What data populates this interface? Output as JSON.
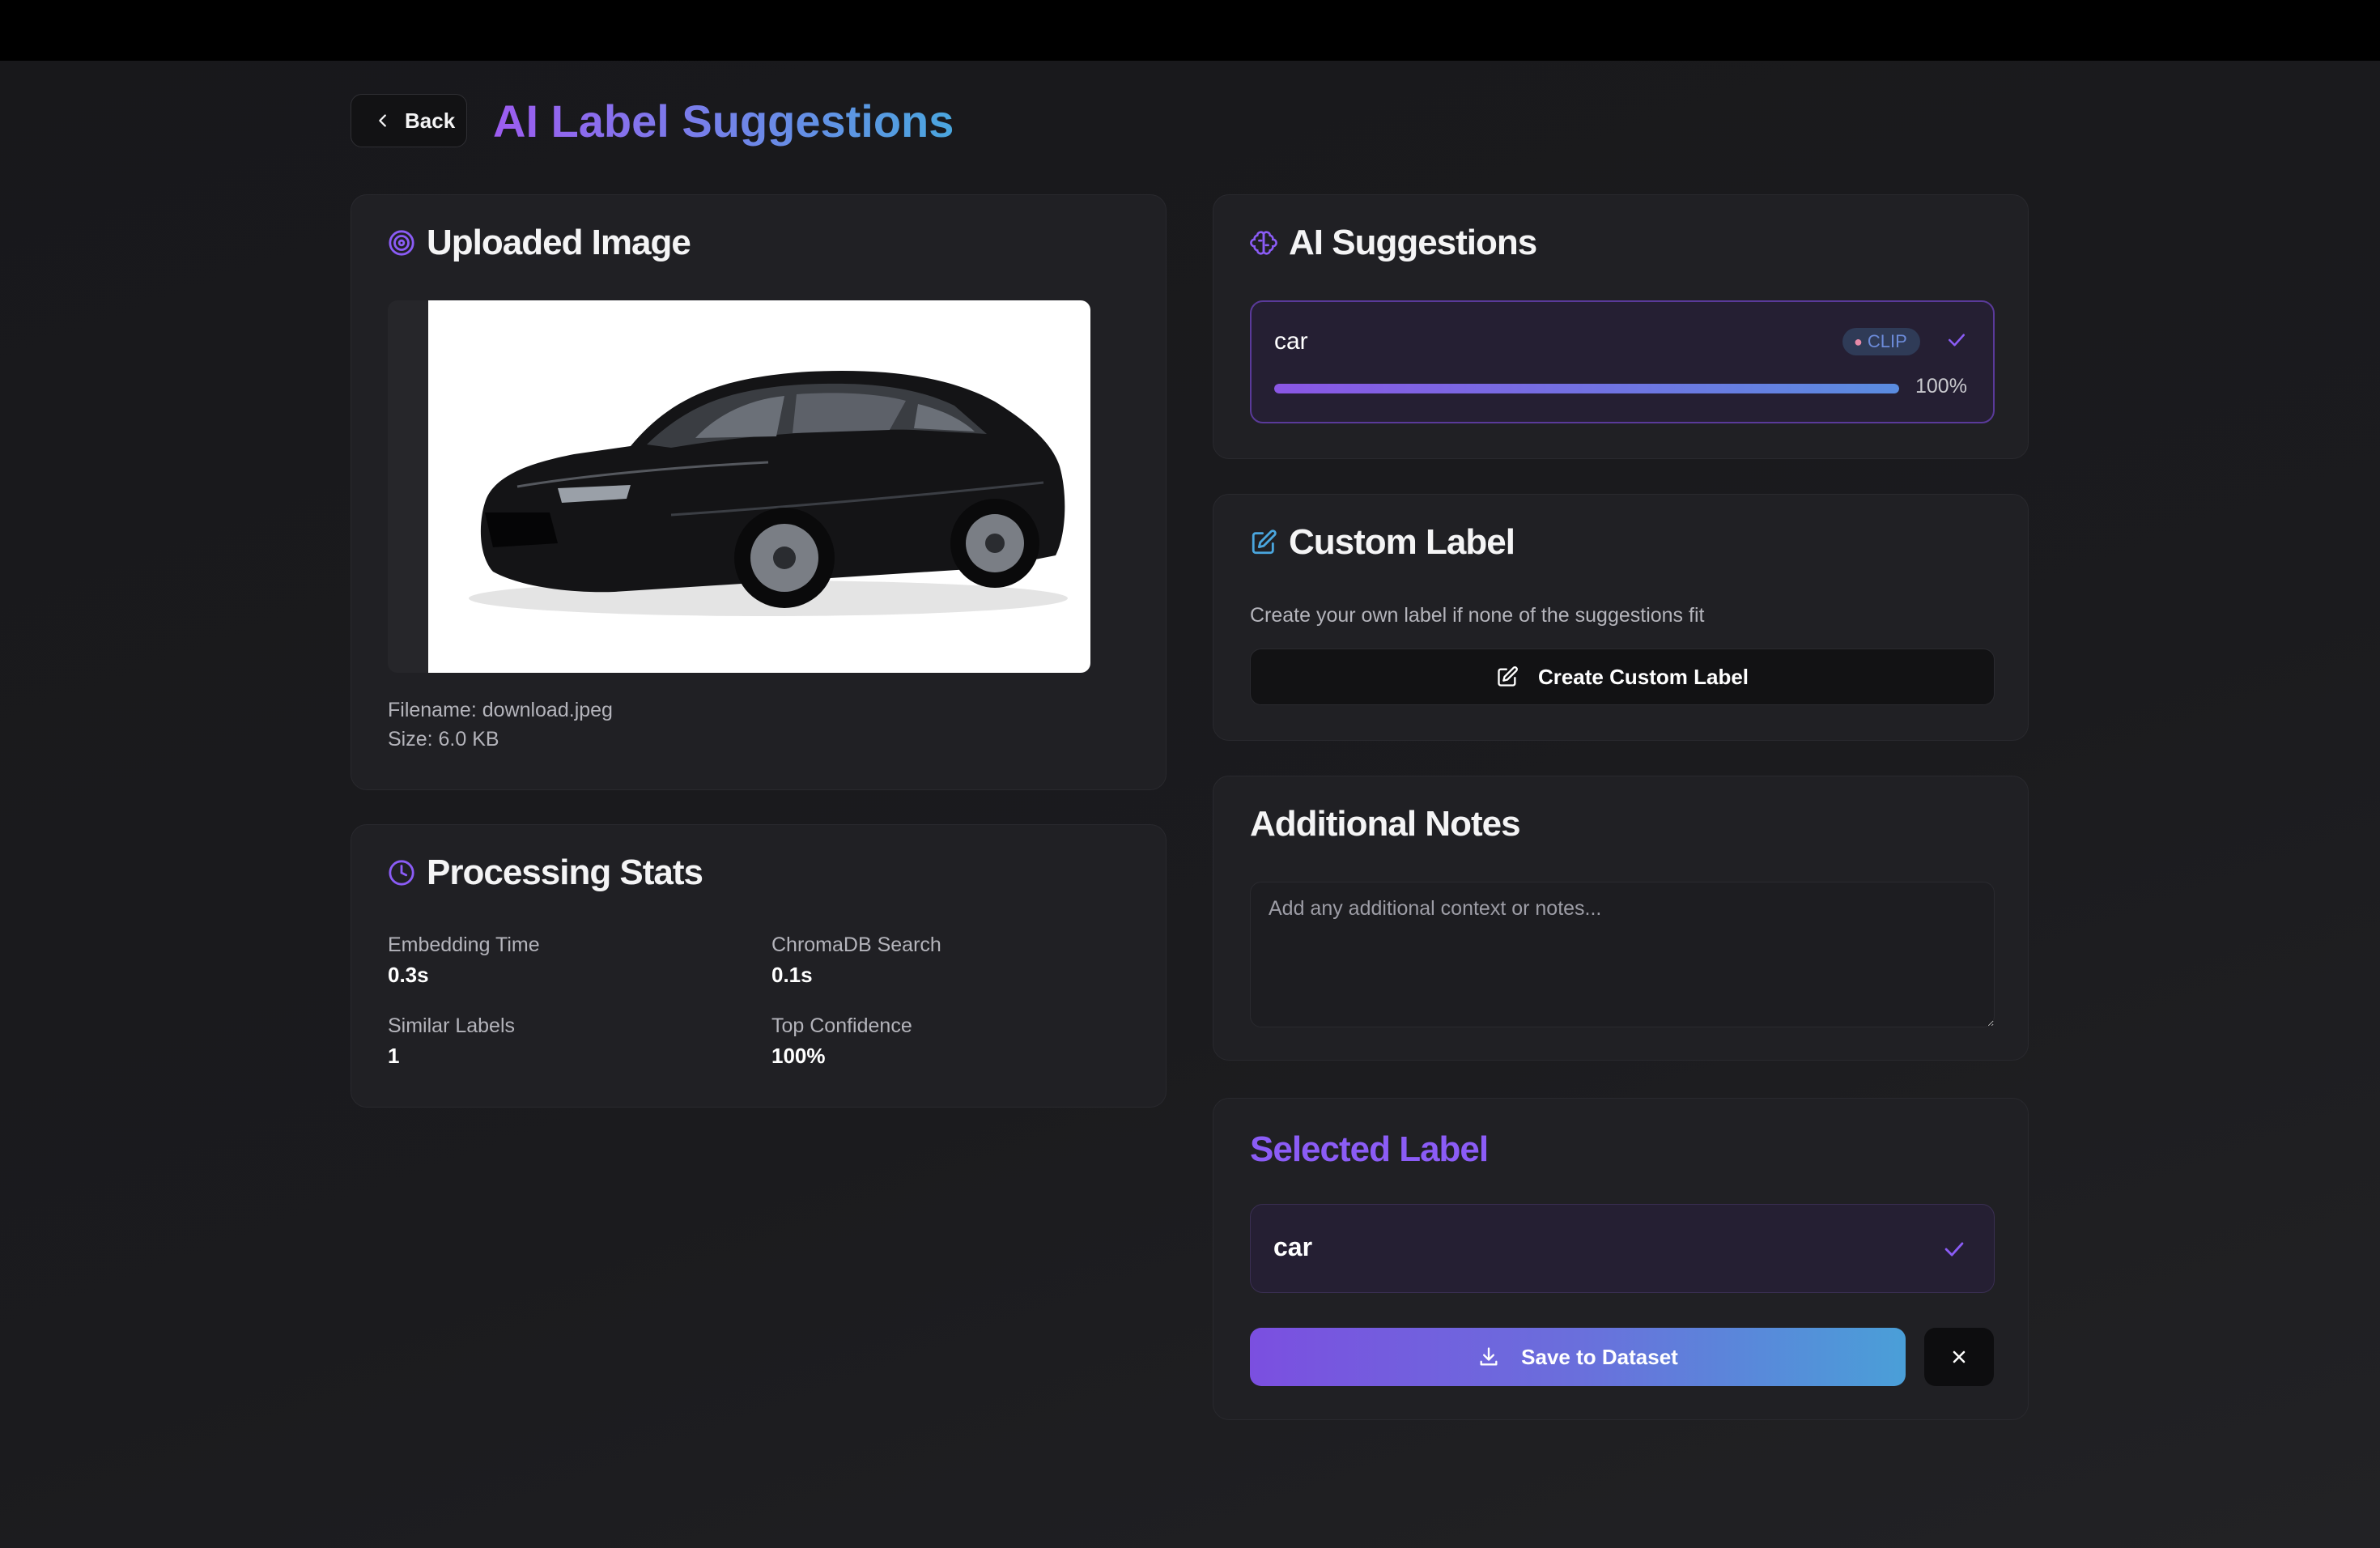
{
  "header": {
    "back_label": "Back",
    "title": "AI Label Suggestions"
  },
  "uploaded_image": {
    "title": "Uploaded Image",
    "filename": "Filename: download.jpeg",
    "size": "Size: 6.0 KB",
    "image_subject": "black sedan car on white background"
  },
  "processing_stats": {
    "title": "Processing Stats",
    "items": [
      {
        "label": "Embedding Time",
        "value": "0.3s"
      },
      {
        "label": "ChromaDB Search",
        "value": "0.1s"
      },
      {
        "label": "Similar Labels",
        "value": "1"
      },
      {
        "label": "Top Confidence",
        "value": "100%"
      }
    ]
  },
  "ai_suggestions": {
    "title": "AI Suggestions",
    "items": [
      {
        "label": "car",
        "source": "CLIP",
        "confidence": 1.0,
        "confidence_text": "100%",
        "selected": true
      }
    ]
  },
  "custom_label": {
    "title": "Custom Label",
    "description": "Create your own label if none of the suggestions fit",
    "button_label": "Create Custom Label"
  },
  "notes": {
    "title": "Additional Notes",
    "placeholder": "Add any additional context or notes...",
    "value": ""
  },
  "selected_label": {
    "title": "Selected Label",
    "value": "car",
    "save_label": "Save to Dataset"
  },
  "colors": {
    "accent_purple": "#8b5cf6",
    "accent_blue": "#4aa6de",
    "background": "#1b1b1e",
    "card": "#202024"
  },
  "icons": [
    "chevron-left-icon",
    "target-icon",
    "brain-icon",
    "clock-icon",
    "edit-icon",
    "check-icon",
    "download-icon",
    "close-icon"
  ]
}
